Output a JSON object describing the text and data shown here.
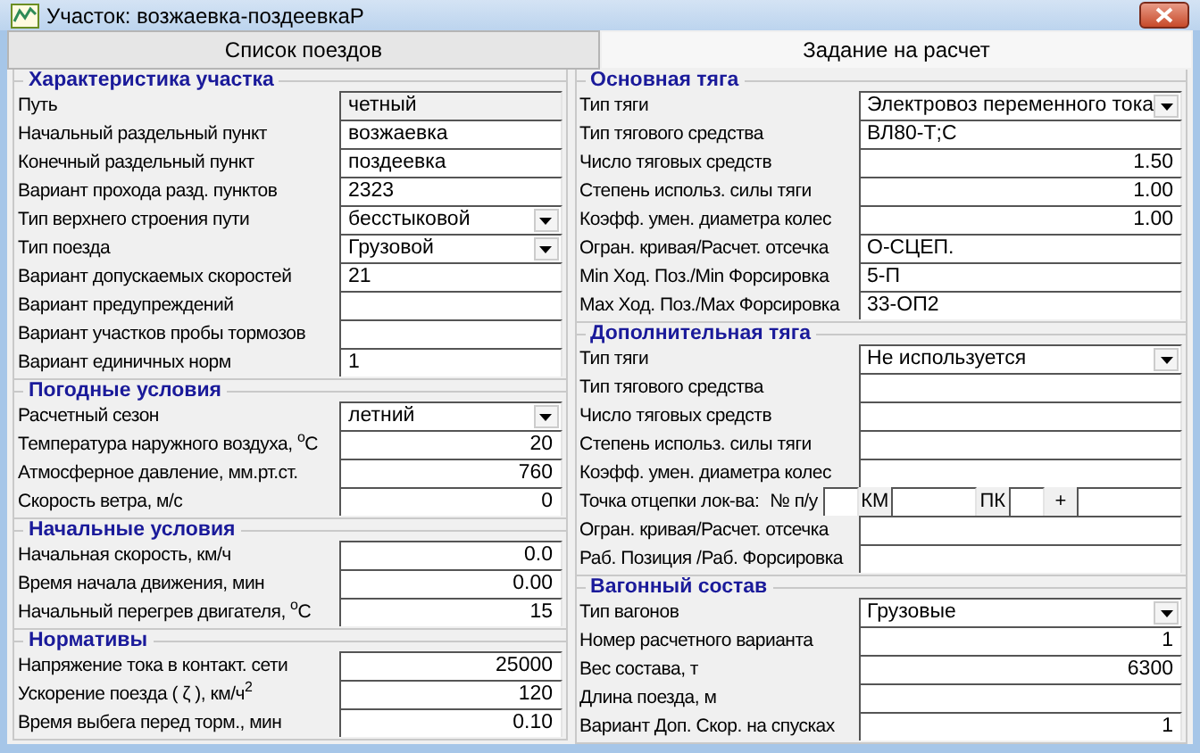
{
  "window": {
    "title": "Участок: возжаевка-поздеевкаР"
  },
  "tabs": [
    {
      "label": "Список поездов",
      "selected": false
    },
    {
      "label": "Задание на расчет",
      "selected": true
    }
  ],
  "panels": [
    {
      "sections": [
        {
          "title": "Характеристика участка",
          "rows": [
            {
              "kind": "readonly",
              "label": "Путь",
              "value": "четный"
            },
            {
              "kind": "text",
              "label": "Начальный раздельный пункт",
              "value": "возжаевка"
            },
            {
              "kind": "text",
              "label": "Конечный раздельный пункт",
              "value": "поздеевка"
            },
            {
              "kind": "text",
              "label": "Вариант прохода разд. пунктов",
              "value": "2323"
            },
            {
              "kind": "select",
              "label": "Тип верхнего строения пути",
              "value": "бесстыковой"
            },
            {
              "kind": "select",
              "label": "Тип поезда",
              "value": "Грузовой"
            },
            {
              "kind": "text",
              "label": "Вариант допускаемых скоростей",
              "value": "21"
            },
            {
              "kind": "text",
              "label": "Вариант предупреждений"
            },
            {
              "kind": "text",
              "label": "Вариант участков пробы тормозов"
            },
            {
              "kind": "text",
              "label": "Вариант единичных норм",
              "value": "1"
            }
          ]
        },
        {
          "title": "Погодные условия",
          "rows": [
            {
              "kind": "select",
              "label": "Расчетный сезон",
              "value": "летний"
            },
            {
              "kind": "number",
              "label": "Температура наружного воздуха, $^{o}$C",
              "value": "20"
            },
            {
              "kind": "number",
              "label": "Атмосферное давление, мм.рт.ст.",
              "value": "760"
            },
            {
              "kind": "number",
              "label": "Скорость ветра, м/с",
              "value": "0"
            }
          ]
        },
        {
          "title": "Начальные условия",
          "rows": [
            {
              "kind": "number",
              "label": "Начальная скорость, км/ч",
              "value": "0.0"
            },
            {
              "kind": "number",
              "label": "Время начала движения, мин",
              "value": "0.00"
            },
            {
              "kind": "number",
              "label": "Начальный перегрев двигателя, $^{o}$C",
              "value": "15"
            }
          ]
        },
        {
          "title": "Нормативы",
          "rows": [
            {
              "kind": "number",
              "label": "Напряжение тока в контакт. сети",
              "value": "25000"
            },
            {
              "kind": "number",
              "label": "Ускорение поезда ( ζ ), км/ч$^{2}$",
              "value": "120"
            },
            {
              "kind": "number",
              "label": "Время выбега перед торм., мин",
              "value": "0.10"
            }
          ]
        }
      ]
    },
    {
      "sections": [
        {
          "title": "Основная тяга",
          "rows": [
            {
              "kind": "select",
              "label": "Тип тяги",
              "value": "Электровоз переменного тока"
            },
            {
              "kind": "text",
              "label": "Тип тягового средства",
              "value": "ВЛ80-Т;С"
            },
            {
              "kind": "number",
              "label": "Число тяговых средств",
              "value": "1.50"
            },
            {
              "kind": "number",
              "label": "Степень использ. силы тяги",
              "value": "1.00"
            },
            {
              "kind": "number",
              "label": "Коэфф. умен. диаметра колес",
              "value": "1.00"
            },
            {
              "kind": "text",
              "label": "Огран. кривая/Расчет. отсечка",
              "value": "О-СЦЕП."
            },
            {
              "kind": "text",
              "label": "Min Ход. Поз./Min Форсировка",
              "value": "5-П"
            },
            {
              "kind": "text",
              "label": "Max Ход. Поз./Max Форсировка",
              "value": "33-ОП2"
            }
          ]
        },
        {
          "title": "Дополнительная тяга",
          "rows": [
            {
              "kind": "select",
              "label": "Тип тяги",
              "value": "Не используется"
            },
            {
              "kind": "text",
              "label": "Тип тягового средства"
            },
            {
              "kind": "text",
              "label": "Число тяговых средств"
            },
            {
              "kind": "text",
              "label": "Степень использ. силы тяги"
            },
            {
              "kind": "text",
              "label": "Коэфф. умен. диаметра колес"
            },
            {
              "kind": "cutoff",
              "label": "Точка отцепки лок-ва:",
              "number_label": "№ п/у",
              "separators": [
                "КМ",
                "ПК",
                "+"
              ]
            },
            {
              "kind": "text",
              "label": "Огран. кривая/Расчет. отсечка"
            },
            {
              "kind": "text",
              "label": "Раб. Позиция /Раб. Форсировка"
            }
          ]
        },
        {
          "title": "Вагонный состав",
          "rows": [
            {
              "kind": "select",
              "label": "Тип вагонов",
              "value": "Грузовые"
            },
            {
              "kind": "number",
              "label": "Номер расчетного варианта",
              "value": "1"
            },
            {
              "kind": "number",
              "label": "Вес состава, т",
              "value": "6300"
            },
            {
              "kind": "text",
              "label": "Длина поезда, м"
            },
            {
              "kind": "number",
              "label": "Вариант Доп. Скор. на спусках",
              "value": "1"
            }
          ]
        }
      ]
    }
  ]
}
